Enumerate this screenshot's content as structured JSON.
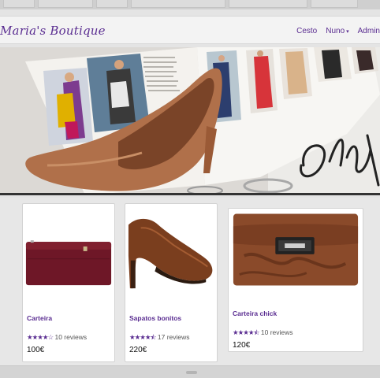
{
  "brand": {
    "name": "Maria's Boutique"
  },
  "nav": {
    "items": [
      {
        "label": "Cesto"
      },
      {
        "label": "Nuno",
        "caret": "▾"
      },
      {
        "label": "Admin"
      }
    ]
  },
  "hero": {
    "description": "Fashion magazine with brown stiletto heel"
  },
  "products": [
    {
      "title": "Carteira",
      "stars": "★★★★☆",
      "reviews": "10 reviews",
      "price": "100€",
      "rating_value": 4
    },
    {
      "title": "Sapatos bonitos",
      "stars": "★★★★⯪",
      "reviews": "17 reviews",
      "price": "220€",
      "rating_value": 4.5
    },
    {
      "title": "Carteira chick",
      "stars": "★★★★⯪",
      "reviews": "10 reviews",
      "price": "120€",
      "rating_value": 4.5
    }
  ],
  "colors": {
    "accent": "#5a2d91",
    "burgundy": "#6e1727",
    "brown": "#8a4a2a"
  }
}
